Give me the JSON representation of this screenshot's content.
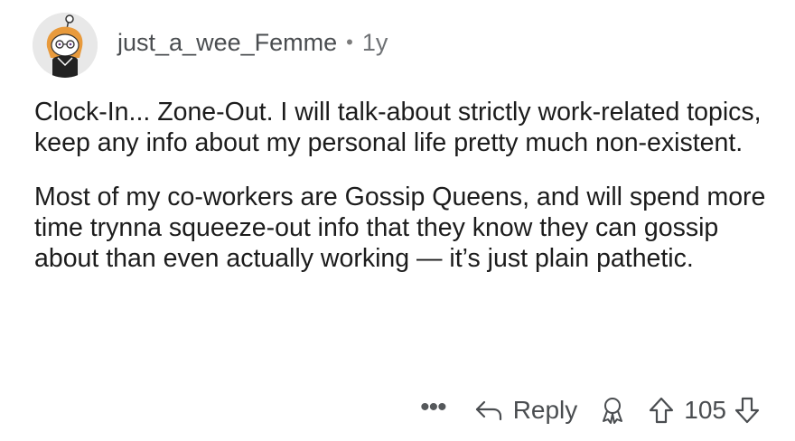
{
  "comment": {
    "username": "just_a_wee_Femme",
    "separator": "•",
    "age": "1y",
    "paragraphs": [
      "Clock-In... Zone-Out. I will talk-about strictly work-related topics, keep any info about my personal life pretty much non-existent.",
      "Most of my co-workers are Gossip Queens, and will spend more time trynna squeeze-out info that they know they can gossip about than even actually working — it’s just plain pathetic."
    ]
  },
  "actions": {
    "more_label": "•••",
    "reply_label": "Reply",
    "vote_count": "105"
  },
  "icons": {
    "more": "more-icon",
    "reply": "reply-arrow-icon",
    "award": "award-icon",
    "upvote": "upvote-icon",
    "downvote": "downvote-icon"
  }
}
